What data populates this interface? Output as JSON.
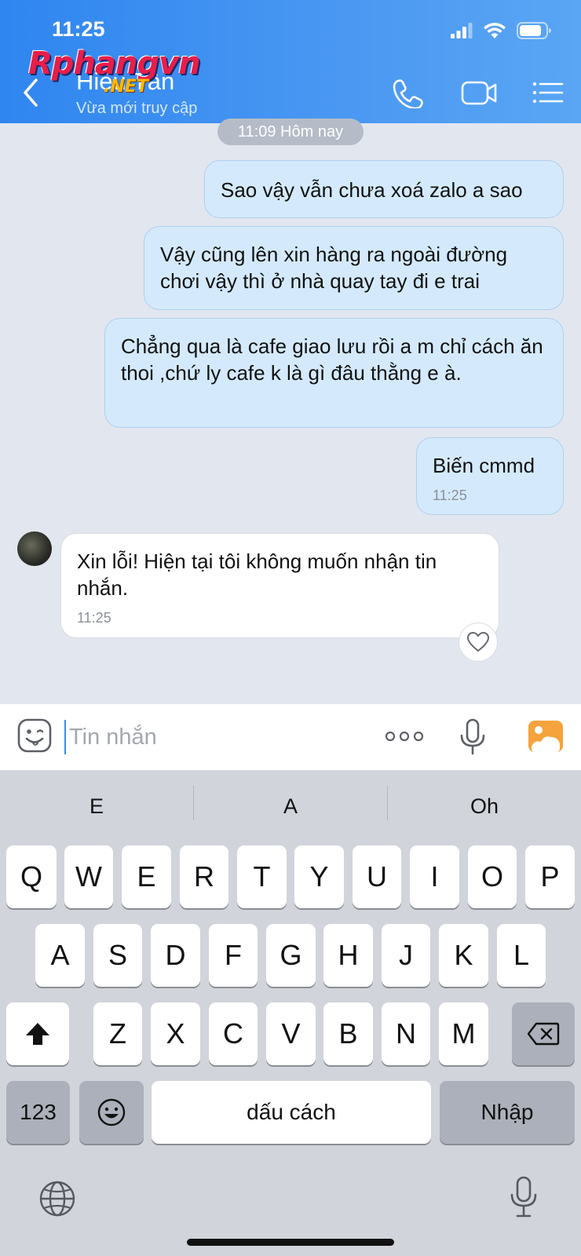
{
  "status_bar": {
    "time": "11:25"
  },
  "header": {
    "contact_name": "Hiếu Tân",
    "contact_status": "Vừa mới truy cập",
    "watermark_main": "Rphangvn",
    "watermark_sub": ".NET",
    "colors": {
      "header_start": "#2f86f0",
      "header_end": "#5aa6f4"
    }
  },
  "chat": {
    "date_separator": "11:09 Hôm nay",
    "messages": [
      {
        "direction": "out",
        "text": "Sao vậy vẫn chưa xoá zalo a sao",
        "time": ""
      },
      {
        "direction": "out",
        "text": "Vậy cũng lên xin hàng ra ngoài đường chơi vậy thì ở nhà quay tay đi e trai",
        "time": ""
      },
      {
        "direction": "out",
        "text": "Chẳng qua là cafe giao lưu rồi a m chỉ cách ăn thoi ,chứ ly cafe k là gì đâu thằng e à.",
        "time": ""
      },
      {
        "direction": "out",
        "text": "Biến cmmd",
        "time": "11:25"
      },
      {
        "direction": "in",
        "text": "Xin lỗi! Hiện tại tôi không muốn nhận tin nhắn.",
        "time": "11:25"
      }
    ],
    "colors": {
      "outgoing_bubble": "#d4eafc",
      "incoming_bubble": "#ffffff"
    }
  },
  "composer": {
    "placeholder": "Tin nhắn",
    "icons": [
      "sticker-icon",
      "more-icon",
      "microphone-icon",
      "photo-icon"
    ]
  },
  "keyboard": {
    "suggestions": [
      "E",
      "A",
      "Oh"
    ],
    "row1": [
      "Q",
      "W",
      "E",
      "R",
      "T",
      "Y",
      "U",
      "I",
      "O",
      "P"
    ],
    "row2": [
      "A",
      "S",
      "D",
      "F",
      "G",
      "H",
      "J",
      "K",
      "L"
    ],
    "row3": [
      "Z",
      "X",
      "C",
      "V",
      "B",
      "N",
      "M"
    ],
    "numbers_key": "123",
    "space_key": "dấu cách",
    "return_key": "Nhập"
  }
}
